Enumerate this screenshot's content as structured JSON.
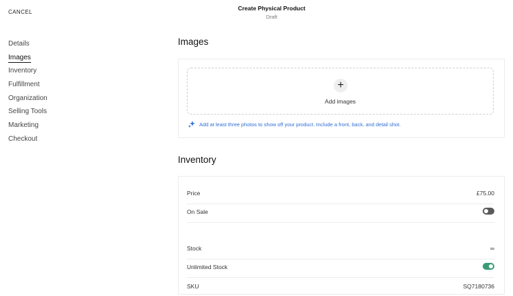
{
  "header": {
    "cancel_label": "CANCEL",
    "title": "Create Physical Product",
    "subtitle": "Draft"
  },
  "sidebar": {
    "items": [
      {
        "label": "Details"
      },
      {
        "label": "Images"
      },
      {
        "label": "Inventory"
      },
      {
        "label": "Fulfillment"
      },
      {
        "label": "Organization"
      },
      {
        "label": "Selling Tools"
      },
      {
        "label": "Marketing"
      },
      {
        "label": "Checkout"
      }
    ],
    "active": "Images"
  },
  "images": {
    "title": "Images",
    "add_label": "Add images",
    "plus_icon": "plus-icon",
    "hint": "Add at least three photos to show off your product. Include a front, back, and detail shot.",
    "hint_icon": "sparkle-icon"
  },
  "inventory": {
    "title": "Inventory",
    "price_label": "Price",
    "price_value": "£75.00",
    "on_sale_label": "On Sale",
    "on_sale": false,
    "stock_label": "Stock",
    "stock_value": "∞",
    "unlimited_label": "Unlimited Stock",
    "unlimited": true,
    "sku_label": "SKU",
    "sku_value": "SQ7180736"
  },
  "colors": {
    "accent_link": "#2f6fd6",
    "toggle_on": "#3c9a75",
    "toggle_off": "#5a5a5a"
  }
}
